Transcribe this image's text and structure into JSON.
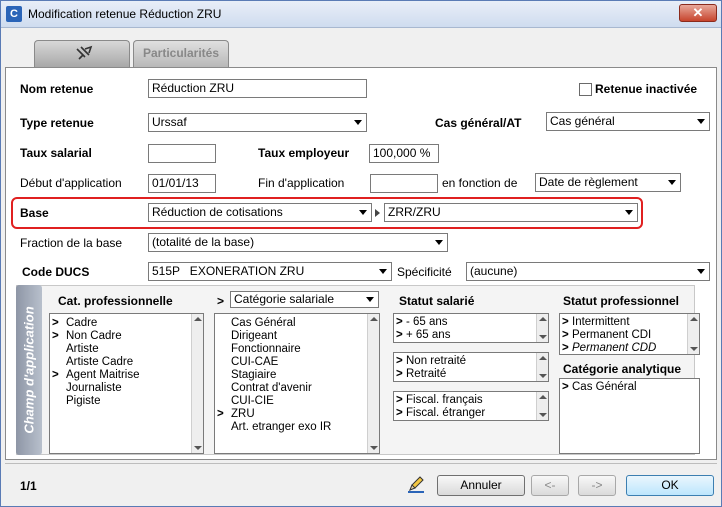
{
  "window": {
    "title": "Modification retenue Réduction ZRU",
    "app_icon": "C"
  },
  "tabs": [
    {
      "label": ""
    },
    {
      "label": "Particularités"
    }
  ],
  "form": {
    "nom_retenue_label": "Nom retenue",
    "nom_retenue_value": "Réduction ZRU",
    "retenue_inactivee_label": "Retenue inactivée",
    "retenue_inactivee_checked": false,
    "type_retenue_label": "Type retenue",
    "type_retenue_value": "Urssaf",
    "cas_general_label": "Cas général/AT",
    "cas_general_value": "Cas général",
    "taux_salarial_label": "Taux salarial",
    "taux_salarial_value": "",
    "taux_employeur_label": "Taux employeur",
    "taux_employeur_value": "100,000 %",
    "debut_application_label": "Début d'application",
    "debut_application_value": "01/01/13",
    "fin_application_label": "Fin d'application",
    "fin_application_value": "",
    "en_fonction_label": "en fonction de",
    "en_fonction_value": "Date de règlement",
    "base_label": "Base",
    "base_value": "Réduction de cotisations",
    "base_sub_value": "ZRR/ZRU",
    "fraction_label": "Fraction de la base",
    "fraction_value": "(totalité de la base)",
    "code_ducs_label": "Code DUCS",
    "code_ducs_value": "515P   EXONERATION ZRU",
    "specificite_label": "Spécificité",
    "specificite_value": "(aucune)"
  },
  "champ": {
    "side_label": "Champ d'application",
    "cat_pro_title": "Cat. professionnelle",
    "cat_pro_items": [
      {
        "mark": ">",
        "label": "Cadre"
      },
      {
        "mark": ">",
        "label": "Non Cadre"
      },
      {
        "mark": "",
        "label": "Artiste"
      },
      {
        "mark": "",
        "label": "Artiste Cadre"
      },
      {
        "mark": ">",
        "label": "Agent Maitrise"
      },
      {
        "mark": "",
        "label": "Journaliste"
      },
      {
        "mark": "",
        "label": "Pigiste"
      }
    ],
    "cat_sal_prefix": ">",
    "cat_sal_select": "Catégorie salariale",
    "cat_sal_items": [
      {
        "mark": "",
        "label": "Cas Général"
      },
      {
        "mark": "",
        "label": "Dirigeant"
      },
      {
        "mark": "",
        "label": "Fonctionnaire"
      },
      {
        "mark": "",
        "label": "CUI-CAE"
      },
      {
        "mark": "",
        "label": "Stagiaire"
      },
      {
        "mark": "",
        "label": "Contrat d'avenir"
      },
      {
        "mark": "",
        "label": "CUI-CIE"
      },
      {
        "mark": ">",
        "label": "ZRU"
      },
      {
        "mark": "",
        "label": "Art. etranger exo IR"
      }
    ],
    "statut_sal_title": "Statut salarié",
    "age_items": [
      {
        "mark": ">",
        "label": " - 65 ans"
      },
      {
        "mark": ">",
        "label": " + 65 ans"
      }
    ],
    "retraite_items": [
      {
        "mark": ">",
        "label": "Non retraité"
      },
      {
        "mark": ">",
        "label": "Retraité"
      }
    ],
    "fiscal_items": [
      {
        "mark": ">",
        "label": "Fiscal. français"
      },
      {
        "mark": ">",
        "label": "Fiscal. étranger"
      }
    ],
    "statut_pro_title": "Statut professionnel",
    "statut_pro_items": [
      {
        "mark": ">",
        "label": "Intermittent"
      },
      {
        "mark": ">",
        "label": "Permanent CDI"
      },
      {
        "mark": ">",
        "label": "Permanent CDD"
      }
    ],
    "cat_ana_title": "Catégorie analytique",
    "cat_ana_items": [
      {
        "mark": ">",
        "label": "Cas Général"
      }
    ]
  },
  "footer": {
    "pager": "1/1",
    "annuler_label": "Annuler",
    "prev_label": "<-",
    "next_label": "->",
    "ok_label": "OK"
  },
  "colors": {
    "highlight_border": "#e02020",
    "title_bar": "#cfdcef",
    "close_button": "#c7442d"
  }
}
